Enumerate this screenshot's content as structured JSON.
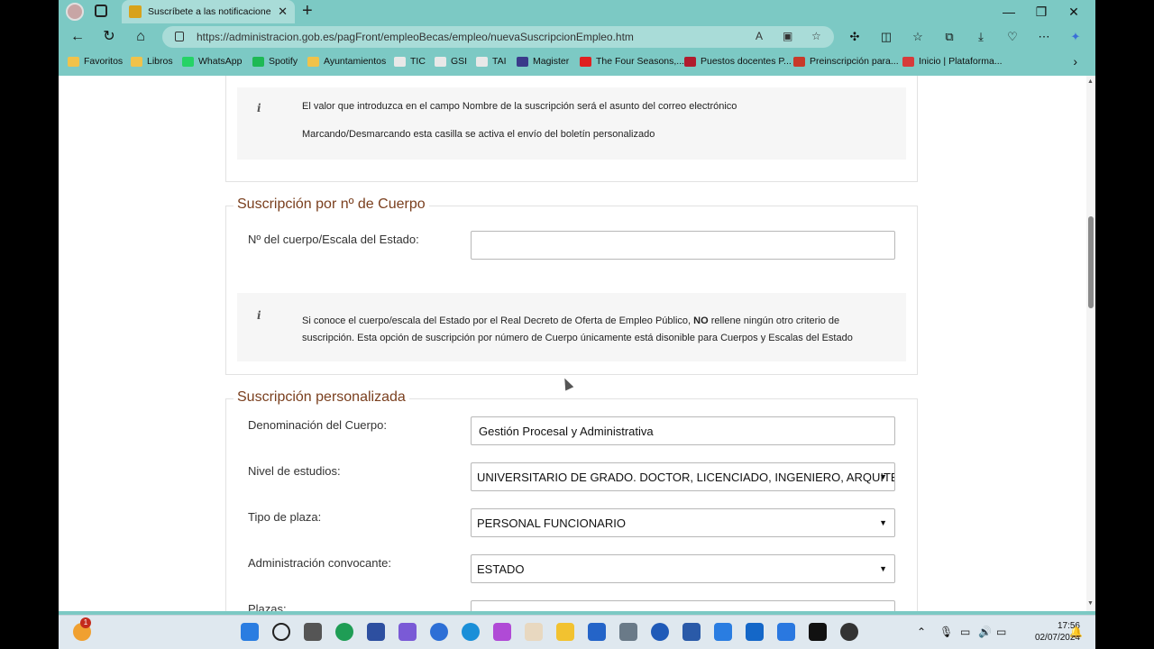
{
  "tab": {
    "title": "Suscríbete a las notificaciones de",
    "close": "✕"
  },
  "window": {
    "minimize": "—",
    "maximize": "❐",
    "close": "✕"
  },
  "address": {
    "url": "https://administracion.gob.es/pagFront/empleoBecas/empleo/nuevaSuscripcionEmpleo.htm"
  },
  "bookmarks": [
    {
      "label": "Favoritos",
      "color": "#f0c24a"
    },
    {
      "label": "Libros",
      "color": "#f0c24a"
    },
    {
      "label": "WhatsApp",
      "color": "#25d366"
    },
    {
      "label": "Spotify",
      "color": "#1db954"
    },
    {
      "label": "Ayuntamientos",
      "color": "#f0c24a"
    },
    {
      "label": "TIC",
      "color": "#e8e8e8"
    },
    {
      "label": "GSI",
      "color": "#e8e8e8"
    },
    {
      "label": "TAI",
      "color": "#e8e8e8"
    },
    {
      "label": "Magister",
      "color": "#3a3a8a"
    },
    {
      "label": "The Four Seasons,...",
      "color": "#e02020"
    },
    {
      "label": "Puestos docentes P...",
      "color": "#b01c2e"
    },
    {
      "label": "Preinscripción para...",
      "color": "#c83a2a"
    },
    {
      "label": "Inicio | Plataforma...",
      "color": "#d63b3b"
    }
  ],
  "info_top": {
    "line1": "El valor que introduzca en el campo Nombre de la suscripción será el asunto del correo electrónico",
    "line2": "Marcando/Desmarcando esta casilla se activa el envío del boletín personalizado"
  },
  "cuerpo_section": {
    "legend": "Suscripción por nº de Cuerpo",
    "label": "Nº del cuerpo/Escala del Estado:",
    "value": "",
    "info_pre": "Si conoce el cuerpo/escala del Estado por el Real Decreto de Oferta de Empleo Público, ",
    "info_bold": "NO",
    "info_post": " rellene ningún otro criterio de suscripción. Esta opción de suscripción por número de Cuerpo únicamente está disonible para Cuerpos y Escalas del Estado"
  },
  "personalizada_section": {
    "legend": "Suscripción personalizada",
    "fields": [
      {
        "label": "Denominación del Cuerpo:",
        "value": "Gestión Procesal y Administrativa"
      },
      {
        "label": "Nivel de estudios:",
        "value": "UNIVERSITARIO DE GRADO. DOCTOR, LICENCIADO, INGENIERO, ARQUITECTO"
      },
      {
        "label": "Tipo de plaza:",
        "value": "PERSONAL FUNCIONARIO"
      },
      {
        "label": "Administración convocante:",
        "value": "ESTADO"
      },
      {
        "label": "Plazas:",
        "value": ""
      }
    ]
  },
  "taskbar": {
    "badge": "1",
    "time": "17:56",
    "date": "02/07/2024"
  }
}
